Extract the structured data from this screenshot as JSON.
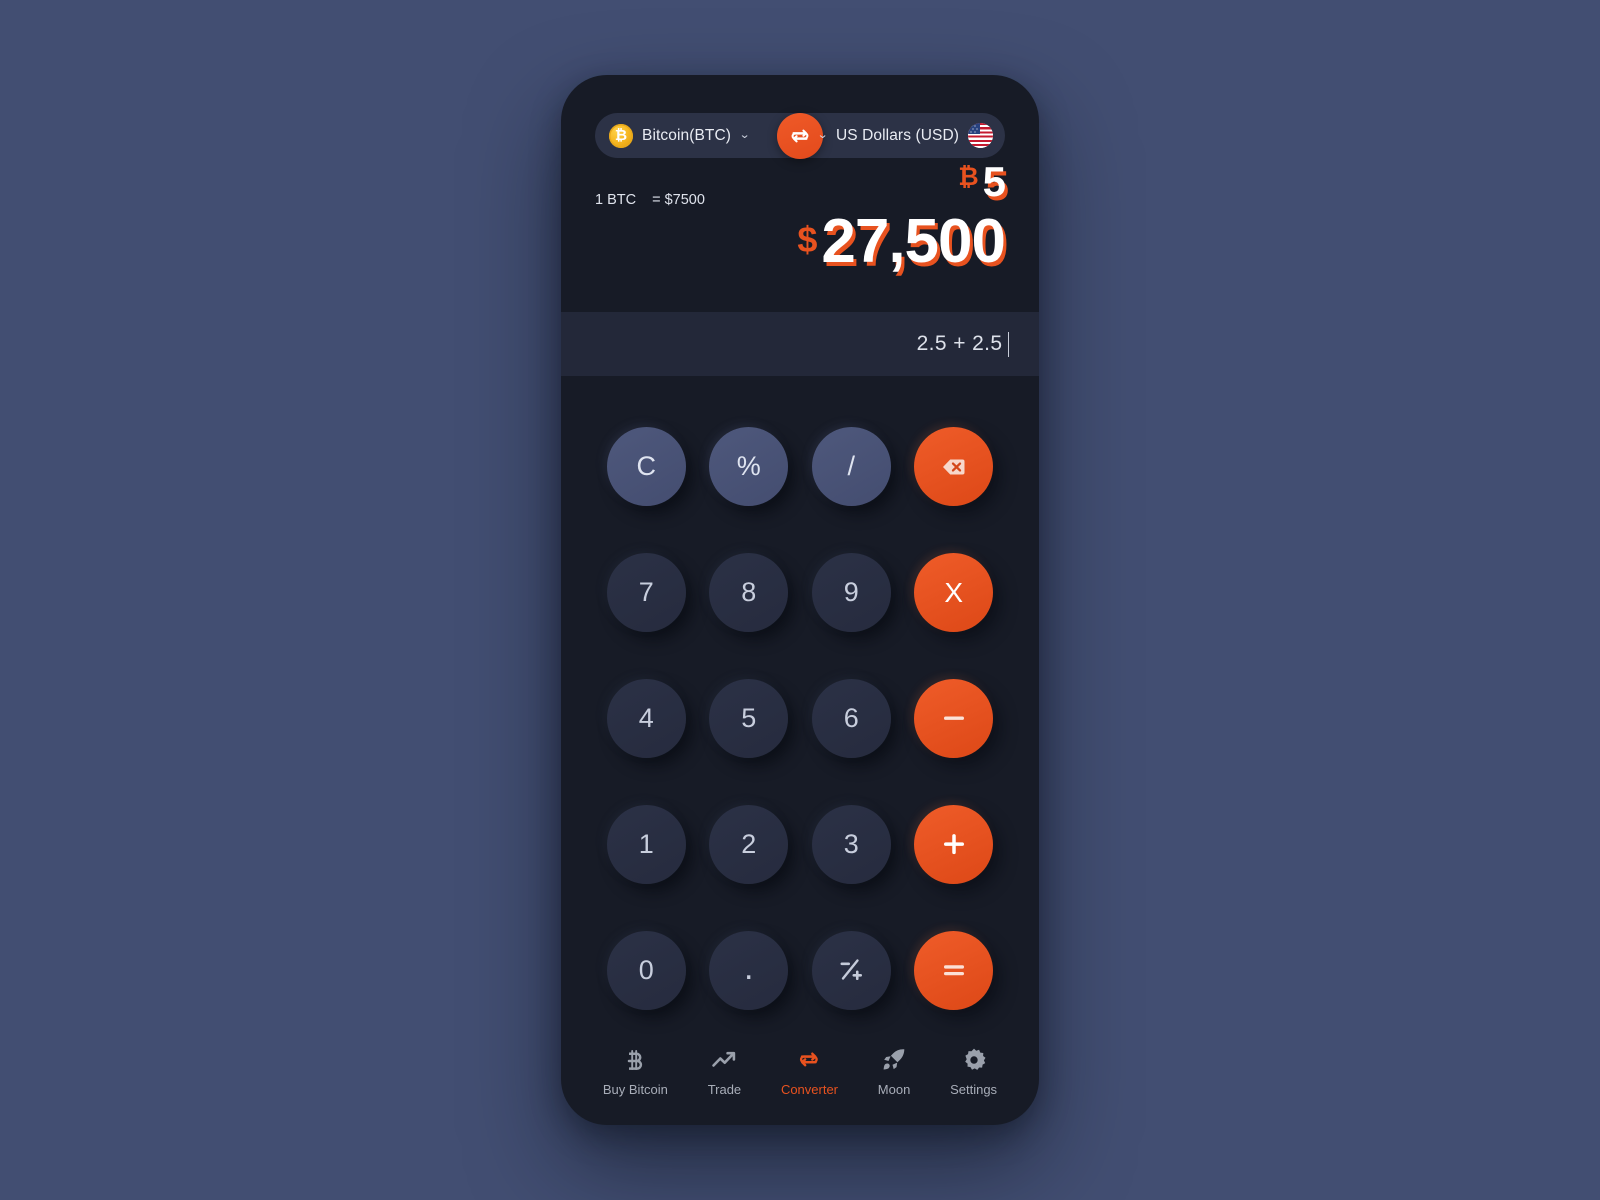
{
  "theme": {
    "page_background": "#424e72",
    "phone_background": "#171b26",
    "accent": "#e8521f",
    "key_dark": "#2b3146",
    "key_light": "#4e587c",
    "text_primary": "#e9ecf3"
  },
  "selector": {
    "from": {
      "label": "Bitcoin(BTC)",
      "icon": "bitcoin-coin-icon",
      "chevron": "⌄"
    },
    "swap": {
      "icon": "swap-arrows-icon",
      "label": "Swap currencies"
    },
    "to": {
      "label": "US Dollars (USD)",
      "icon": "us-flag-icon",
      "chevron": "⌄"
    }
  },
  "display": {
    "rate_from": "1 BTC",
    "rate_to": "= $7500",
    "from_symbol": "₿",
    "from_amount": "5",
    "to_symbol": "$",
    "to_amount": "27,500"
  },
  "expression": {
    "value": "2.5 + 2.5"
  },
  "keypad": {
    "keys": [
      {
        "label": "C",
        "name": "clear-key",
        "style": "light"
      },
      {
        "label": "%",
        "name": "percent-key",
        "style": "light"
      },
      {
        "label": "/",
        "name": "divide-key",
        "style": "light"
      },
      {
        "label": "",
        "name": "backspace-key",
        "style": "orange",
        "icon": "backspace-icon"
      },
      {
        "label": "7",
        "name": "digit-7-key",
        "style": "dark"
      },
      {
        "label": "8",
        "name": "digit-8-key",
        "style": "dark"
      },
      {
        "label": "9",
        "name": "digit-9-key",
        "style": "dark"
      },
      {
        "label": "X",
        "name": "multiply-key",
        "style": "orange"
      },
      {
        "label": "4",
        "name": "digit-4-key",
        "style": "dark"
      },
      {
        "label": "5",
        "name": "digit-5-key",
        "style": "dark"
      },
      {
        "label": "6",
        "name": "digit-6-key",
        "style": "dark"
      },
      {
        "label": "",
        "name": "minus-key",
        "style": "orange",
        "icon": "minus-icon"
      },
      {
        "label": "1",
        "name": "digit-1-key",
        "style": "dark"
      },
      {
        "label": "2",
        "name": "digit-2-key",
        "style": "dark"
      },
      {
        "label": "3",
        "name": "digit-3-key",
        "style": "dark"
      },
      {
        "label": "",
        "name": "plus-key",
        "style": "orange",
        "icon": "plus-icon"
      },
      {
        "label": "0",
        "name": "digit-0-key",
        "style": "dark"
      },
      {
        "label": ".",
        "name": "decimal-key",
        "style": "dark"
      },
      {
        "label": "",
        "name": "sign-toggle-key",
        "style": "dark",
        "icon": "plus-minus-icon"
      },
      {
        "label": "",
        "name": "equals-key",
        "style": "orange",
        "icon": "equals-icon"
      }
    ]
  },
  "nav": {
    "items": [
      {
        "label": "Buy Bitcoin",
        "icon": "bitcoin-icon",
        "name": "nav-buy-bitcoin",
        "active": false
      },
      {
        "label": "Trade",
        "icon": "trending-up-icon",
        "name": "nav-trade",
        "active": false
      },
      {
        "label": "Converter",
        "icon": "swap-arrows-icon",
        "name": "nav-converter",
        "active": true
      },
      {
        "label": "Moon",
        "icon": "rocket-icon",
        "name": "nav-moon",
        "active": false
      },
      {
        "label": "Settings",
        "icon": "gear-icon",
        "name": "nav-settings",
        "active": false
      }
    ]
  }
}
